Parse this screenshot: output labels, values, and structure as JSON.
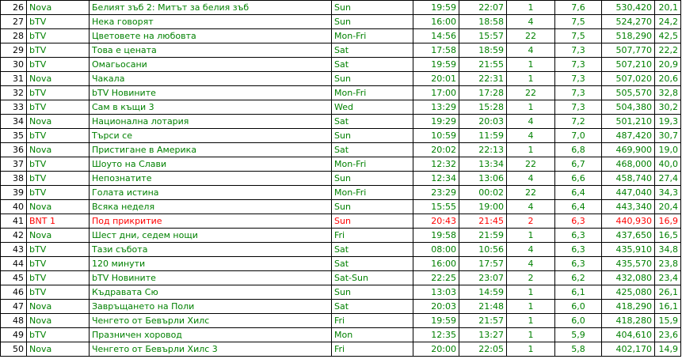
{
  "colors": {
    "default_text": "#008000",
    "highlight_text": "#ff0000",
    "rank_text": "#000000",
    "grid": "#000000"
  },
  "rows": [
    {
      "rank": "26",
      "channel": "Nova",
      "title": "Белият зъб 2: Митът за белия зъб",
      "day": "Sun",
      "start": "19:59",
      "end": "22:07",
      "count": "1",
      "rating": "7,6",
      "viewers": "530,420",
      "share": "20,1",
      "highlight": false
    },
    {
      "rank": "27",
      "channel": "bTV",
      "title": "Нека говорят",
      "day": "Sun",
      "start": "16:00",
      "end": "18:58",
      "count": "4",
      "rating": "7,5",
      "viewers": "524,270",
      "share": "24,2",
      "highlight": false
    },
    {
      "rank": "28",
      "channel": "bTV",
      "title": "Цветовете на любовта",
      "day": "Mon-Fri",
      "start": "14:56",
      "end": "15:57",
      "count": "22",
      "rating": "7,5",
      "viewers": "518,290",
      "share": "42,5",
      "highlight": false
    },
    {
      "rank": "29",
      "channel": "bTV",
      "title": "Това е цената",
      "day": "Sat",
      "start": "17:58",
      "end": "18:59",
      "count": "4",
      "rating": "7,3",
      "viewers": "507,770",
      "share": "22,2",
      "highlight": false
    },
    {
      "rank": "30",
      "channel": "bTV",
      "title": "Омагьосани",
      "day": "Sat",
      "start": "19:59",
      "end": "21:55",
      "count": "1",
      "rating": "7,3",
      "viewers": "507,210",
      "share": "20,9",
      "highlight": false
    },
    {
      "rank": "31",
      "channel": "Nova",
      "title": "Чакала",
      "day": "Sun",
      "start": "20:01",
      "end": "22:31",
      "count": "1",
      "rating": "7,3",
      "viewers": "507,020",
      "share": "20,6",
      "highlight": false
    },
    {
      "rank": "32",
      "channel": "bTV",
      "title": "bTV Новините",
      "day": "Mon-Fri",
      "start": "17:00",
      "end": "17:28",
      "count": "22",
      "rating": "7,3",
      "viewers": "505,570",
      "share": "32,8",
      "highlight": false
    },
    {
      "rank": "33",
      "channel": "bTV",
      "title": "Сам в къщи 3",
      "day": "Wed",
      "start": "13:29",
      "end": "15:28",
      "count": "1",
      "rating": "7,3",
      "viewers": "504,380",
      "share": "30,2",
      "highlight": false
    },
    {
      "rank": "34",
      "channel": "Nova",
      "title": "Национална лотария",
      "day": "Sat",
      "start": "19:29",
      "end": "20:03",
      "count": "4",
      "rating": "7,2",
      "viewers": "501,210",
      "share": "19,3",
      "highlight": false
    },
    {
      "rank": "35",
      "channel": "bTV",
      "title": "Търси се",
      "day": "Sun",
      "start": "10:59",
      "end": "11:59",
      "count": "4",
      "rating": "7,0",
      "viewers": "487,420",
      "share": "30,7",
      "highlight": false
    },
    {
      "rank": "36",
      "channel": "Nova",
      "title": "Пристигане в Америка",
      "day": "Sat",
      "start": "20:02",
      "end": "22:13",
      "count": "1",
      "rating": "6,8",
      "viewers": "469,900",
      "share": "19,0",
      "highlight": false
    },
    {
      "rank": "37",
      "channel": "bTV",
      "title": "Шоуто на Слави",
      "day": "Mon-Fri",
      "start": "12:32",
      "end": "13:34",
      "count": "22",
      "rating": "6,7",
      "viewers": "468,000",
      "share": "40,0",
      "highlight": false
    },
    {
      "rank": "38",
      "channel": "bTV",
      "title": "Непознатите",
      "day": "Sun",
      "start": "12:34",
      "end": "13:06",
      "count": "4",
      "rating": "6,6",
      "viewers": "458,740",
      "share": "27,4",
      "highlight": false
    },
    {
      "rank": "39",
      "channel": "bTV",
      "title": "Голата истина",
      "day": "Mon-Fri",
      "start": "23:29",
      "end": "00:02",
      "count": "22",
      "rating": "6,4",
      "viewers": "447,040",
      "share": "34,3",
      "highlight": false
    },
    {
      "rank": "40",
      "channel": "Nova",
      "title": "Всяка неделя",
      "day": "Sun",
      "start": "15:55",
      "end": "19:00",
      "count": "4",
      "rating": "6,4",
      "viewers": "443,340",
      "share": "20,4",
      "highlight": false
    },
    {
      "rank": "41",
      "channel": "BNT 1",
      "title": "Под прикритие",
      "day": "Sun",
      "start": "20:43",
      "end": "21:45",
      "count": "2",
      "rating": "6,3",
      "viewers": "440,930",
      "share": "16,9",
      "highlight": true
    },
    {
      "rank": "42",
      "channel": "Nova",
      "title": "Шест дни, седем нощи",
      "day": "Fri",
      "start": "19:58",
      "end": "21:59",
      "count": "1",
      "rating": "6,3",
      "viewers": "437,650",
      "share": "16,5",
      "highlight": false
    },
    {
      "rank": "43",
      "channel": "bTV",
      "title": "Тази събота",
      "day": "Sat",
      "start": "08:00",
      "end": "10:56",
      "count": "4",
      "rating": "6,3",
      "viewers": "435,910",
      "share": "34,8",
      "highlight": false
    },
    {
      "rank": "44",
      "channel": "bTV",
      "title": "120 минути",
      "day": "Sat",
      "start": "16:00",
      "end": "17:57",
      "count": "4",
      "rating": "6,3",
      "viewers": "435,570",
      "share": "23,8",
      "highlight": false
    },
    {
      "rank": "45",
      "channel": "bTV",
      "title": "bTV Новините",
      "day": "Sat-Sun",
      "start": "22:25",
      "end": "23:07",
      "count": "2",
      "rating": "6,2",
      "viewers": "432,080",
      "share": "23,4",
      "highlight": false
    },
    {
      "rank": "46",
      "channel": "bTV",
      "title": "Къдравата Сю",
      "day": "Sun",
      "start": "13:03",
      "end": "14:59",
      "count": "1",
      "rating": "6,1",
      "viewers": "425,080",
      "share": "26,1",
      "highlight": false
    },
    {
      "rank": "47",
      "channel": "Nova",
      "title": "Завръщането на Поли",
      "day": "Sat",
      "start": "20:03",
      "end": "21:48",
      "count": "1",
      "rating": "6,0",
      "viewers": "418,290",
      "share": "16,1",
      "highlight": false
    },
    {
      "rank": "48",
      "channel": "Nova",
      "title": "Ченгето от Бевърли Хилс",
      "day": "Fri",
      "start": "19:59",
      "end": "21:57",
      "count": "1",
      "rating": "6,0",
      "viewers": "418,280",
      "share": "15,9",
      "highlight": false
    },
    {
      "rank": "49",
      "channel": "bTV",
      "title": "Празничен хоровод",
      "day": "Mon",
      "start": "12:35",
      "end": "13:27",
      "count": "1",
      "rating": "5,9",
      "viewers": "404,610",
      "share": "23,6",
      "highlight": false
    },
    {
      "rank": "50",
      "channel": "Nova",
      "title": "Ченгето от Бевърли Хилс 3",
      "day": "Fri",
      "start": "20:00",
      "end": "22:05",
      "count": "1",
      "rating": "5,8",
      "viewers": "402,170",
      "share": "14,9",
      "highlight": false
    }
  ]
}
